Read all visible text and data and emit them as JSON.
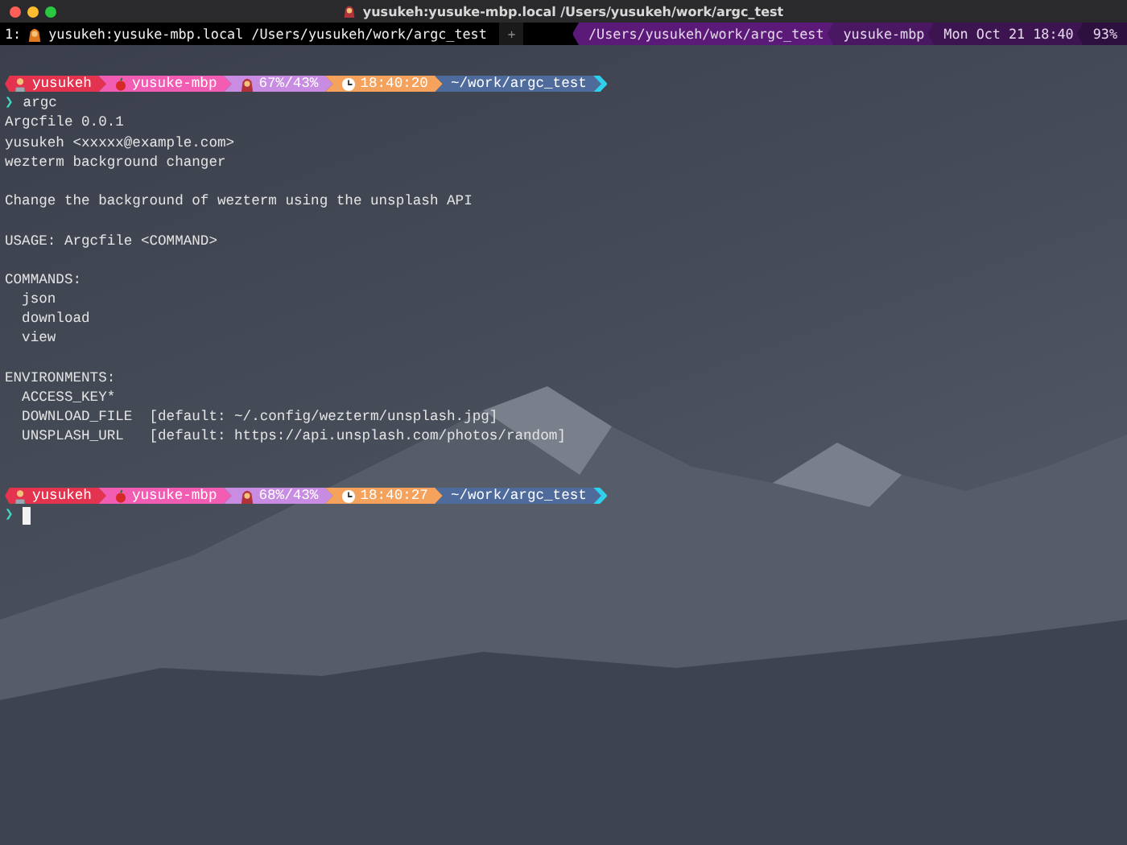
{
  "window": {
    "title": "yusukeh:yusuke-mbp.local /Users/yusukeh/work/argc_test"
  },
  "tab_bar": {
    "tabs": [
      {
        "index": "1:",
        "title": "yusukeh:yusuke-mbp.local /Users/yusukeh/work/argc_test",
        "selected": true
      }
    ],
    "new_tab": "+",
    "status": [
      {
        "text": "/Users/yusukeh/work/argc_test",
        "color": "#5b1a78"
      },
      {
        "text": "yusuke-mbp",
        "color": "#4a1763"
      },
      {
        "text": "Mon Oct 21 18:40",
        "color": "#3c1450"
      },
      {
        "text": "93%",
        "color": "#2e103e"
      }
    ]
  },
  "terminal": {
    "sessions": [
      {
        "prompt": [
          {
            "kind": "user",
            "text": "yusukeh",
            "color": "#e3334f"
          },
          {
            "kind": "host",
            "text": "yusuke-mbp",
            "color": "#f25db3"
          },
          {
            "kind": "memory",
            "text": "67%/43%",
            "color": "#c88de2"
          },
          {
            "kind": "time",
            "text": "18:40:20",
            "color": "#f5a35c"
          },
          {
            "kind": "path",
            "text": "~/work/argc_test",
            "color": "#4f6b9c"
          }
        ],
        "command_mark": "❯",
        "command": "argc",
        "output_blocks": [
          [
            "Argcfile 0.0.1",
            "yusukeh <xxxxx@example.com>",
            "wezterm background changer"
          ],
          [
            "Change the background of wezterm using the unsplash API"
          ],
          [
            "USAGE: Argcfile <COMMAND>"
          ],
          [
            "COMMANDS:",
            "  json",
            "  download",
            "  view"
          ],
          [
            "ENVIRONMENTS:",
            "  ACCESS_KEY*",
            "  DOWNLOAD_FILE  [default: ~/.config/wezterm/unsplash.jpg]",
            "  UNSPLASH_URL   [default: https://api.unsplash.com/photos/random]"
          ]
        ]
      },
      {
        "prompt": [
          {
            "kind": "user",
            "text": "yusukeh",
            "color": "#e3334f"
          },
          {
            "kind": "host",
            "text": "yusuke-mbp",
            "color": "#f25db3"
          },
          {
            "kind": "memory",
            "text": "68%/43%",
            "color": "#c88de2"
          },
          {
            "kind": "time",
            "text": "18:40:27",
            "color": "#f5a35c"
          },
          {
            "kind": "path",
            "text": "~/work/argc_test",
            "color": "#4f6b9c"
          }
        ],
        "command_mark": "❯"
      }
    ]
  }
}
